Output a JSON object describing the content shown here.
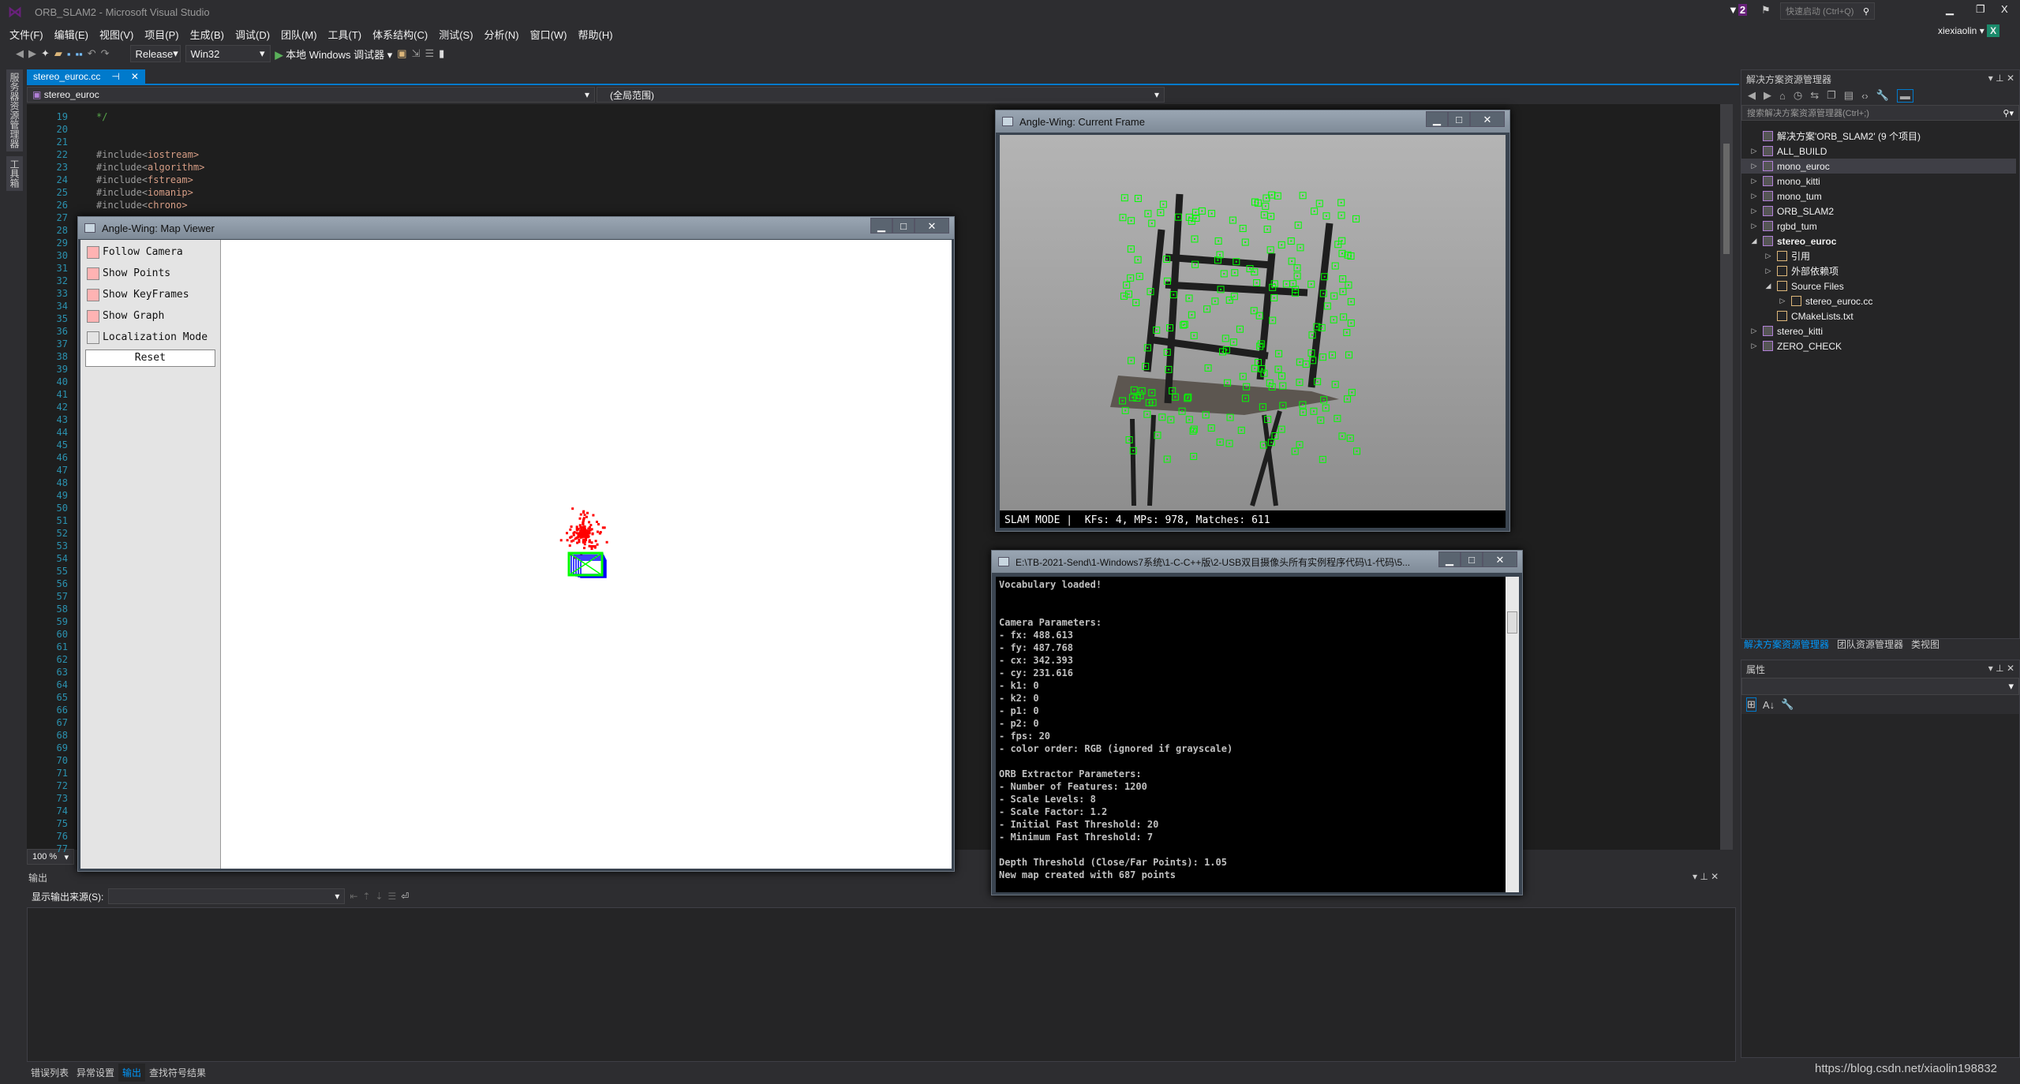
{
  "window": {
    "title": "ORB_SLAM2 - Microsoft Visual Studio",
    "quick_launch_placeholder": "快速启动 (Ctrl+Q)",
    "notification_count": "2",
    "user": "xiexiaolin",
    "user_initial": "X"
  },
  "menu": [
    "文件(F)",
    "编辑(E)",
    "视图(V)",
    "项目(P)",
    "生成(B)",
    "调试(D)",
    "团队(M)",
    "工具(T)",
    "体系结构(C)",
    "测试(S)",
    "分析(N)",
    "窗口(W)",
    "帮助(H)"
  ],
  "toolbar": {
    "config": "Release",
    "platform": "Win32",
    "run_label": "本地 Windows 调试器"
  },
  "left_strip": [
    "服务器资源管理器",
    "工具箱"
  ],
  "editor": {
    "tab": "stereo_euroc.cc",
    "nav_project": "stereo_euroc",
    "nav_scope": "(全局范围)",
    "zoom": "100 %",
    "first_line": 19,
    "last_line": 77,
    "lines": [
      {
        "n": 19,
        "text": "*/",
        "kind": "comment"
      },
      {
        "n": 22,
        "pre": "#include<",
        "arg": "iostream"
      },
      {
        "n": 23,
        "pre": "#include<",
        "arg": "algorithm"
      },
      {
        "n": 24,
        "pre": "#include<",
        "arg": "fstream"
      },
      {
        "n": 25,
        "pre": "#include<",
        "arg": "iomanip"
      },
      {
        "n": 26,
        "pre": "#include<",
        "arg": "chrono"
      }
    ]
  },
  "map_viewer": {
    "title": "Angle-Wing: Map Viewer",
    "options": [
      {
        "label": "Follow Camera",
        "checked": true
      },
      {
        "label": "Show Points",
        "checked": true
      },
      {
        "label": "Show KeyFrames",
        "checked": true
      },
      {
        "label": "Show Graph",
        "checked": true
      },
      {
        "label": "Localization Mode",
        "checked": false
      }
    ],
    "reset": "Reset",
    "colors": {
      "points": "#ff0000",
      "keyframe": "#00ff00",
      "frames": "#0000ff"
    }
  },
  "current_frame": {
    "title": "Angle-Wing: Current Frame",
    "status": "SLAM MODE |  KFs: 4, MPs: 978, Matches: 611",
    "feature_color": "#00ff00"
  },
  "console": {
    "title": "E:\\TB-2021-Send\\1-Windows7系统\\1-C-C++版\\2-USB双目摄像头所有实例程序代码\\1-代码\\5...",
    "lines": [
      "Vocabulary loaded!",
      "",
      "",
      "Camera Parameters:",
      "- fx: 488.613",
      "- fy: 487.768",
      "- cx: 342.393",
      "- cy: 231.616",
      "- k1: 0",
      "- k2: 0",
      "- p1: 0",
      "- p2: 0",
      "- fps: 20",
      "- color order: RGB (ignored if grayscale)",
      "",
      "ORB Extractor Parameters:",
      "- Number of Features: 1200",
      "- Scale Levels: 8",
      "- Scale Factor: 1.2",
      "- Initial Fast Threshold: 20",
      "- Minimum Fast Threshold: 7",
      "",
      "Depth Threshold (Close/Far Points): 1.05",
      "New map created with 687 points"
    ]
  },
  "solution_explorer": {
    "title": "解决方案资源管理器",
    "search_placeholder": "搜索解决方案资源管理器(Ctrl+;)",
    "items": [
      {
        "label": "解决方案'ORB_SLAM2' (9 个项目)",
        "level": 0,
        "arrow": ""
      },
      {
        "label": "ALL_BUILD",
        "level": 0,
        "arrow": "▷"
      },
      {
        "label": "mono_euroc",
        "level": 0,
        "arrow": "▷",
        "selected": true
      },
      {
        "label": "mono_kitti",
        "level": 0,
        "arrow": "▷"
      },
      {
        "label": "mono_tum",
        "level": 0,
        "arrow": "▷"
      },
      {
        "label": "ORB_SLAM2",
        "level": 0,
        "arrow": "▷"
      },
      {
        "label": "rgbd_tum",
        "level": 0,
        "arrow": "▷"
      },
      {
        "label": "stereo_euroc",
        "level": 0,
        "arrow": "◢",
        "bold": true
      },
      {
        "label": "引用",
        "level": 1,
        "arrow": "▷"
      },
      {
        "label": "外部依赖项",
        "level": 1,
        "arrow": "▷"
      },
      {
        "label": "Source Files",
        "level": 1,
        "arrow": "◢"
      },
      {
        "label": "stereo_euroc.cc",
        "level": 2,
        "arrow": "▷"
      },
      {
        "label": "CMakeLists.txt",
        "level": 1,
        "arrow": ""
      },
      {
        "label": "stereo_kitti",
        "level": 0,
        "arrow": "▷"
      },
      {
        "label": "ZERO_CHECK",
        "level": 0,
        "arrow": "▷"
      }
    ],
    "tabs": [
      "解决方案资源管理器",
      "团队资源管理器",
      "类视图"
    ]
  },
  "properties": {
    "title": "属性"
  },
  "output": {
    "title": "输出",
    "source_label": "显示输出来源(S):",
    "tabs": [
      "错误列表",
      "异常设置",
      "输出",
      "查找符号结果"
    ],
    "active_tab": 2
  },
  "watermark": "https://blog.csdn.net/xiaolin198832",
  "colors": {
    "accent": "#007acc",
    "bg": "#2d2d30",
    "editor_bg": "#1e1e1e",
    "line_number": "#2b91af"
  }
}
